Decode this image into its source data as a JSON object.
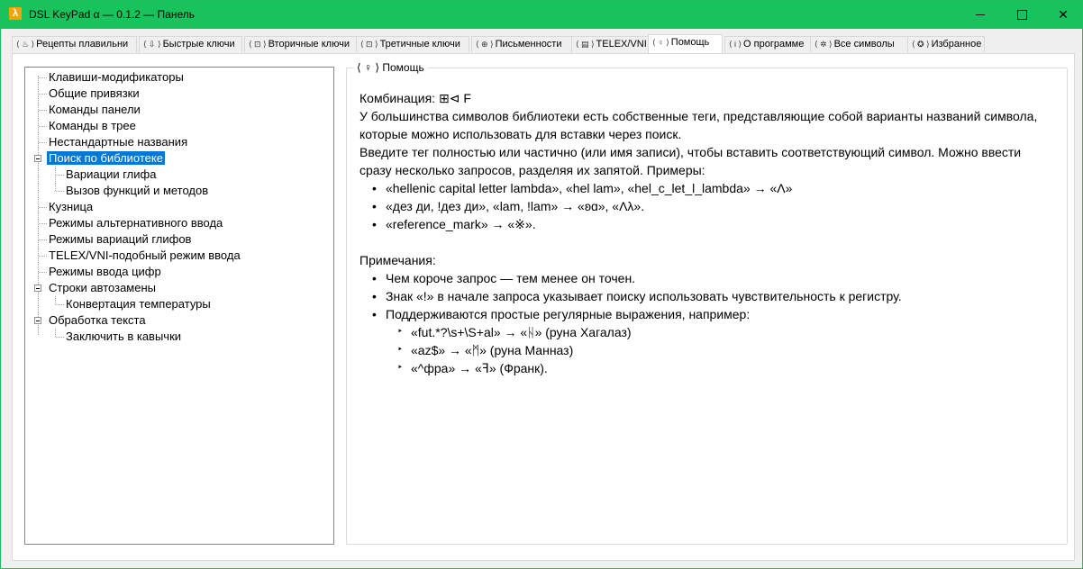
{
  "window": {
    "title": "DSL KeyPad α — 0.1.2 — Панель",
    "app_icon_glyph": "λ",
    "minimize_icon": "minimize-icon",
    "maximize_icon": "maximize-icon",
    "close_glyph": "✕"
  },
  "tabs": [
    {
      "icon": "⟨ ♨ ⟩",
      "label": "Рецепты плавильни"
    },
    {
      "icon": "⟨ ⇩ ⟩",
      "label": "Быстрые ключи"
    },
    {
      "icon": "⟨ ⊡ ⟩",
      "label": "Вторичные ключи"
    },
    {
      "icon": "⟨ ⊡ ⟩",
      "label": "Третичные ключи"
    },
    {
      "icon": "⟨ ⊕ ⟩",
      "label": "Письменности"
    },
    {
      "icon": "⟨ ▤ ⟩",
      "label": "TELEX/VNI"
    },
    {
      "icon": "⟨ ♀ ⟩",
      "label": "Помощь"
    },
    {
      "icon": "⟨ i ⟩",
      "label": "О программе"
    },
    {
      "icon": "⟨ ✲ ⟩",
      "label": "Все символы"
    },
    {
      "icon": "⟨ ✪ ⟩",
      "label": "Избранное"
    }
  ],
  "active_tab": "Помощь",
  "tree": {
    "items": [
      {
        "label": "Клавиши-модификаторы",
        "level": 0
      },
      {
        "label": "Общие привязки",
        "level": 0
      },
      {
        "label": "Команды панели",
        "level": 0
      },
      {
        "label": "Команды в трее",
        "level": 0
      },
      {
        "label": "Нестандартные названия",
        "level": 0
      },
      {
        "label": "Поиск по библиотеке",
        "level": 0,
        "expanded": true,
        "selected": true
      },
      {
        "label": "Вариации глифа",
        "level": 1
      },
      {
        "label": "Вызов функций и методов",
        "level": 1
      },
      {
        "label": "Кузница",
        "level": 0
      },
      {
        "label": "Режимы альтернативного ввода",
        "level": 0
      },
      {
        "label": "Режимы вариаций глифов",
        "level": 0
      },
      {
        "label": "TELEX/VNI-подобный режим ввода",
        "level": 0
      },
      {
        "label": "Режимы ввода цифр",
        "level": 0
      },
      {
        "label": "Строки автозамены",
        "level": 0,
        "expanded": true
      },
      {
        "label": "Конвертация температуры",
        "level": 1
      },
      {
        "label": "Обработка текста",
        "level": 0,
        "expanded": true
      },
      {
        "label": "Заключить в кавычки",
        "level": 1
      }
    ]
  },
  "help": {
    "group_title": "⟨ ♀ ⟩ Помощь",
    "combo_line": "Комбинация: ⊞⊲ F",
    "intro": "У большинства символов библиотеки есть собственные теги, представляющие собой варианты названий символа, которые можно использовать для вставки через поиск.",
    "instruction": "Введите тег полностью или частично (или имя записи), чтобы вставить соответствующий символ. Можно ввести сразу несколько запросов, разделяя их запятой. Примеры:",
    "examples": [
      "«hellenic capital letter lambda», «hel lam», «hel_c_let_l_lambda» → «Λ»",
      "«дез ди, !дез ди», «lam, !lam» → «ʚɑ», «Λλ».",
      "«reference_mark» → «※»."
    ],
    "notes_title": "Примечания:",
    "notes": [
      "Чем короче запрос — тем менее он точен.",
      "Знак «!» в начале запроса указывает поиску использовать чувствительность к регистру.",
      "Поддерживаются простые регулярные выражения, например:"
    ],
    "regex_examples": [
      "«fut.*?\\s+\\S+al» → «ᚺ» (руна Хагалаз)",
      "«az$» → «ᛗ» (руна Манназ)",
      "«^фра» → «ꟻ» (Франк)."
    ]
  }
}
